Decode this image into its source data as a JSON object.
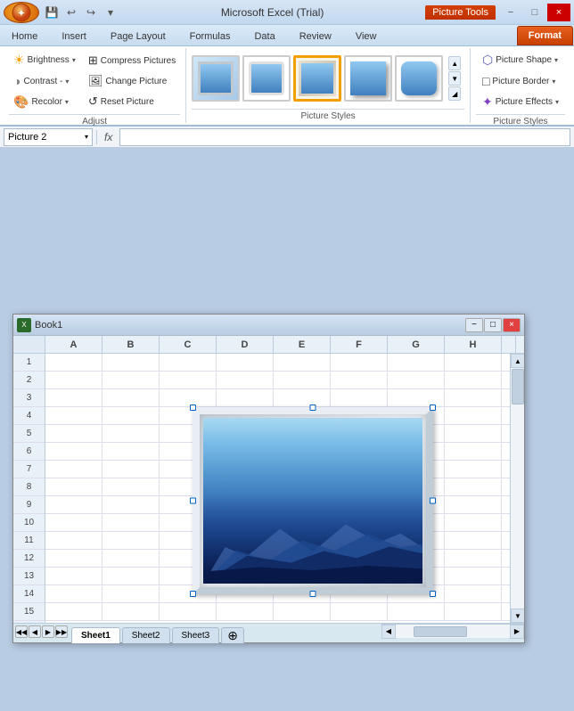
{
  "titleBar": {
    "appName": "Microsoft Excel (Trial)",
    "pictureBadge": "Picture Tools",
    "windowControls": [
      "−",
      "□",
      "×"
    ]
  },
  "ribbon": {
    "tabs": [
      {
        "id": "home",
        "label": "Home",
        "active": false
      },
      {
        "id": "insert",
        "label": "Insert",
        "active": false
      },
      {
        "id": "pagelayout",
        "label": "Page Layout",
        "active": false
      },
      {
        "id": "formulas",
        "label": "Formulas",
        "active": false
      },
      {
        "id": "data",
        "label": "Data",
        "active": false
      },
      {
        "id": "review",
        "label": "Review",
        "active": false
      },
      {
        "id": "view",
        "label": "View",
        "active": false
      },
      {
        "id": "format",
        "label": "Format",
        "active": true,
        "special": true
      }
    ],
    "groups": {
      "adjust": {
        "label": "Adjust",
        "buttons": [
          {
            "id": "brightness",
            "label": "Brightness",
            "icon": "☀"
          },
          {
            "id": "contrast",
            "label": "Contrast -",
            "icon": "◑"
          },
          {
            "id": "recolor",
            "label": "Recolor",
            "icon": "🎨"
          }
        ],
        "rightButtons": [
          {
            "id": "compress",
            "label": "Compress Pictures",
            "icon": "⊞"
          },
          {
            "id": "change",
            "label": "Change Picture",
            "icon": "🖼"
          },
          {
            "id": "reset",
            "label": "Reset Picture",
            "icon": "↺"
          }
        ]
      },
      "pictureStyles": {
        "label": "Picture Styles",
        "thumbs": [
          {
            "id": "style1",
            "active": false
          },
          {
            "id": "style2",
            "active": false
          },
          {
            "id": "style3",
            "active": true
          },
          {
            "id": "style4",
            "active": false
          },
          {
            "id": "style5",
            "active": false
          }
        ]
      },
      "arrange": {
        "label": "Picture Styles",
        "buttons": [
          {
            "id": "picshape",
            "label": "Picture Shape",
            "icon": "⬡"
          },
          {
            "id": "picborder",
            "label": "Picture Border",
            "icon": "□"
          },
          {
            "id": "piceffects",
            "label": "Picture Effects",
            "icon": "✦"
          }
        ]
      }
    }
  },
  "formulaBar": {
    "nameBox": "Picture 2",
    "fxLabel": "fx",
    "formula": ""
  },
  "spreadsheet": {
    "title": "Book1",
    "columns": [
      "A",
      "B",
      "C",
      "D",
      "E",
      "F",
      "G",
      "H"
    ],
    "rows": [
      "1",
      "2",
      "3",
      "4",
      "5",
      "6",
      "7",
      "8",
      "9",
      "10",
      "11",
      "12",
      "13",
      "14",
      "15"
    ],
    "sheets": [
      "Sheet1",
      "Sheet2",
      "Sheet3"
    ]
  }
}
